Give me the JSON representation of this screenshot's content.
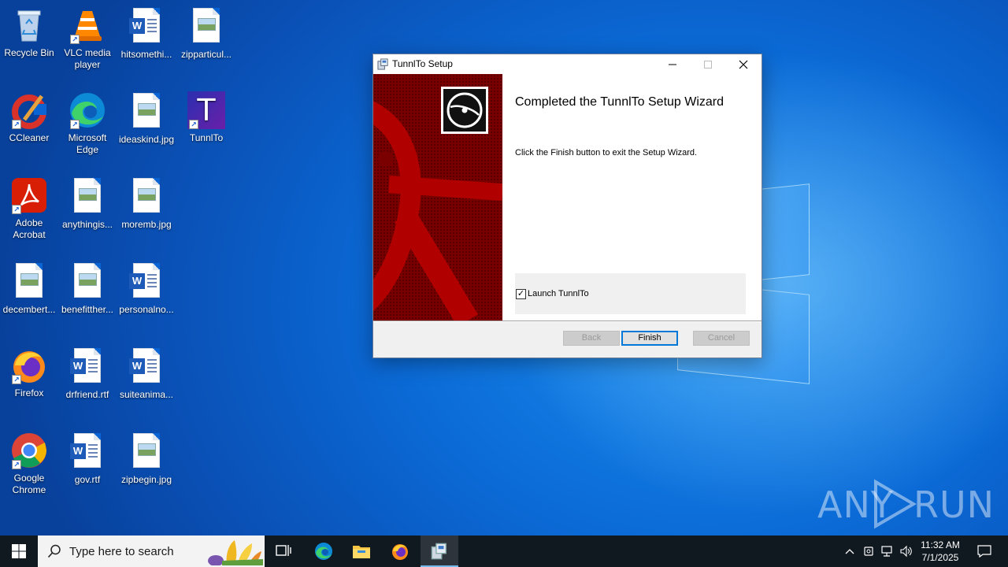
{
  "desktop": {
    "icons": [
      {
        "label": "Recycle Bin",
        "icon": "recycle-bin-icon"
      },
      {
        "label": "VLC media player",
        "icon": "vlc-icon"
      },
      {
        "label": "hitsomethi...",
        "icon": "word-doc-icon"
      },
      {
        "label": "zipparticul...",
        "icon": "image-file-icon"
      },
      {
        "label": "CCleaner",
        "icon": "ccleaner-icon"
      },
      {
        "label": "Microsoft Edge",
        "icon": "edge-icon"
      },
      {
        "label": "ideaskind.jpg",
        "icon": "image-file-icon"
      },
      {
        "label": "TunnlTo",
        "icon": "tunnlto-icon"
      },
      {
        "label": "Adobe Acrobat",
        "icon": "acrobat-icon"
      },
      {
        "label": "anythingis...",
        "icon": "image-file-icon"
      },
      {
        "label": "moremb.jpg",
        "icon": "image-file-icon"
      },
      {
        "label": "decembert...",
        "icon": "image-file-icon"
      },
      {
        "label": "benefitther...",
        "icon": "image-file-icon"
      },
      {
        "label": "personalno...",
        "icon": "word-doc-icon"
      },
      {
        "label": "Firefox",
        "icon": "firefox-icon"
      },
      {
        "label": "drfriend.rtf",
        "icon": "word-doc-icon"
      },
      {
        "label": "suiteanima...",
        "icon": "word-doc-icon"
      },
      {
        "label": "Google Chrome",
        "icon": "chrome-icon"
      },
      {
        "label": "gov.rtf",
        "icon": "word-doc-icon"
      },
      {
        "label": "zipbegin.jpg",
        "icon": "image-file-icon"
      }
    ]
  },
  "setup_window": {
    "title": "TunnlTo Setup",
    "heading": "Completed the TunnlTo Setup Wizard",
    "description": "Click the Finish button to exit the Setup Wizard.",
    "launch_label": "Launch TunnlTo",
    "launch_checked": true,
    "back_label": "Back",
    "finish_label": "Finish",
    "cancel_label": "Cancel",
    "banner_color": "#8e0000",
    "tunnlto_letter": "T"
  },
  "taskbar": {
    "search_placeholder": "Type here to search",
    "time": "11:32 AM",
    "date": "7/1/2025",
    "accent_color": "#76b9ed"
  },
  "watermark": {
    "text_left": "ANY",
    "text_right": "RUN"
  }
}
